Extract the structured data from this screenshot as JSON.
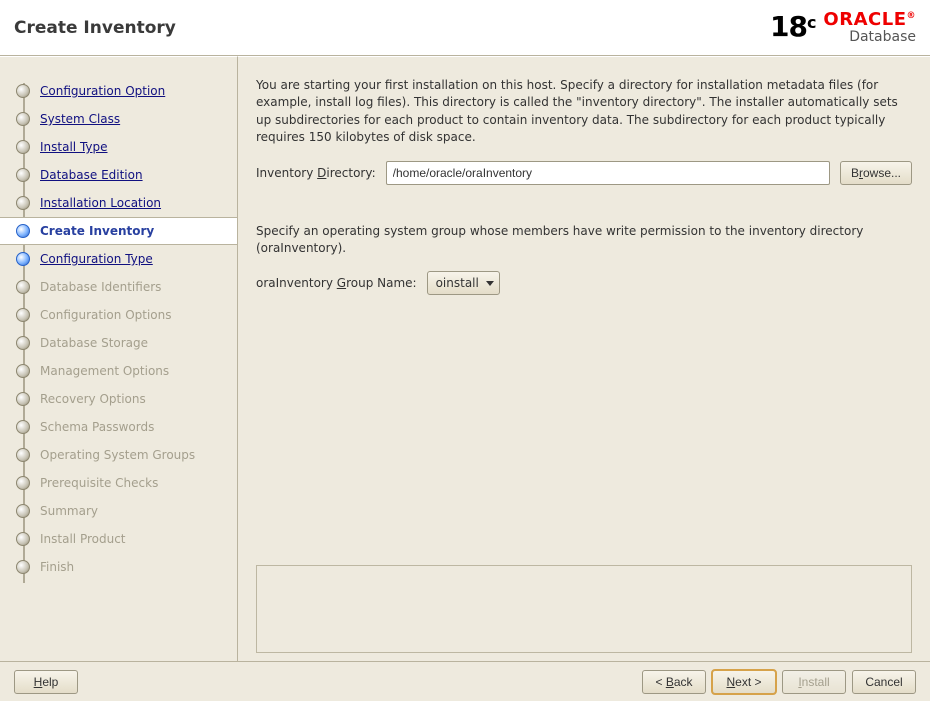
{
  "header": {
    "title": "Create Inventory",
    "version": "18",
    "version_suffix": "c",
    "brand": "ORACLE",
    "brand_reg": "®",
    "product": "Database"
  },
  "sidebar": {
    "items": [
      {
        "label": "Configuration Option",
        "state": "done"
      },
      {
        "label": "System Class",
        "state": "done"
      },
      {
        "label": "Install Type",
        "state": "done"
      },
      {
        "label": "Database Edition",
        "state": "done"
      },
      {
        "label": "Installation Location",
        "state": "done"
      },
      {
        "label": "Create Inventory",
        "state": "current"
      },
      {
        "label": "Configuration Type",
        "state": "next"
      },
      {
        "label": "Database Identifiers",
        "state": "disabled"
      },
      {
        "label": "Configuration Options",
        "state": "disabled"
      },
      {
        "label": "Database Storage",
        "state": "disabled"
      },
      {
        "label": "Management Options",
        "state": "disabled"
      },
      {
        "label": "Recovery Options",
        "state": "disabled"
      },
      {
        "label": "Schema Passwords",
        "state": "disabled"
      },
      {
        "label": "Operating System Groups",
        "state": "disabled"
      },
      {
        "label": "Prerequisite Checks",
        "state": "disabled"
      },
      {
        "label": "Summary",
        "state": "disabled"
      },
      {
        "label": "Install Product",
        "state": "disabled"
      },
      {
        "label": "Finish",
        "state": "disabled"
      }
    ]
  },
  "content": {
    "desc1": "You are starting your first installation on this host. Specify a directory for installation metadata files (for example, install log files). This directory is called the \"inventory directory\". The installer automatically sets up subdirectories for each product to contain inventory data. The subdirectory for each product typically requires 150 kilobytes of disk space.",
    "inv_dir_label_pre": "Inventory ",
    "inv_dir_label_acc": "D",
    "inv_dir_label_post": "irectory:",
    "inv_dir_value": "/home/oracle/oraInventory",
    "browse_pre": "B",
    "browse_acc": "r",
    "browse_post": "owse...",
    "desc2": "Specify an operating system group whose members have write permission to the inventory directory (oraInventory).",
    "group_label_pre": "oraInventory ",
    "group_label_acc": "G",
    "group_label_post": "roup Name:",
    "group_value": "oinstall"
  },
  "footer": {
    "help_acc": "H",
    "help_post": "elp",
    "back_pre": "< ",
    "back_acc": "B",
    "back_post": "ack",
    "next_acc": "N",
    "next_post": "ext >",
    "install_acc": "I",
    "install_post": "nstall",
    "cancel": "Cancel"
  }
}
